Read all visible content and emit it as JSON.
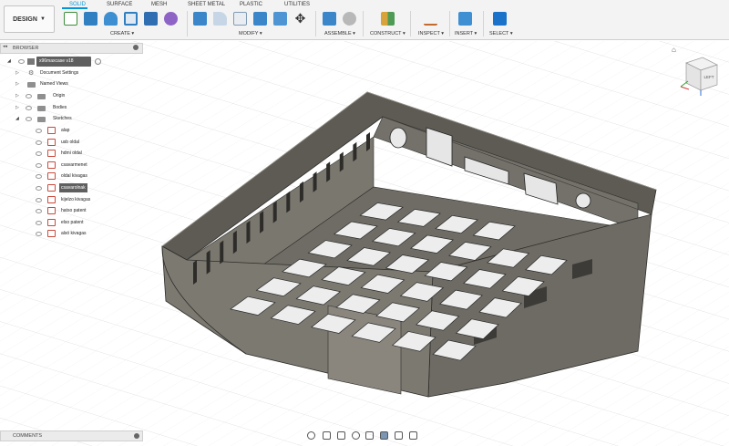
{
  "workspace": {
    "label": "DESIGN"
  },
  "tabs": [
    {
      "id": "solid",
      "label": "SOLID",
      "active": true
    },
    {
      "id": "surface",
      "label": "SURFACE"
    },
    {
      "id": "mesh",
      "label": "MESH"
    },
    {
      "id": "sheet-metal",
      "label": "SHEET METAL"
    },
    {
      "id": "plastic",
      "label": "PLASTIC"
    },
    {
      "id": "utilities",
      "label": "UTILITIES"
    }
  ],
  "groups": {
    "create": "CREATE",
    "modify": "MODIFY",
    "assemble": "ASSEMBLE",
    "construct": "CONSTRUCT",
    "inspect": "INSPECT",
    "insert": "INSERT",
    "select": "SELECT"
  },
  "browser": {
    "title": "BROWSER",
    "root": "x96maxcase v18",
    "nodes": [
      "Document Settings",
      "Named Views",
      "Origin",
      "Bodies",
      "Sketches"
    ],
    "sketches": [
      "alap",
      "usb oldal",
      "hdmi oldal",
      "csavarmenet",
      "oldal kivagas",
      "csavarolnak",
      "kijelzo kivagas",
      "hatso patent",
      "elso patent",
      "alsó kivagas"
    ]
  },
  "comments": {
    "title": "COMMENTS"
  },
  "viewcube": {
    "face": "LEFT"
  },
  "colors": {
    "accent": "#0696d7",
    "body": "#6d6a63",
    "bodyDark": "#3f3d39",
    "grid": "#d9d9d9"
  }
}
